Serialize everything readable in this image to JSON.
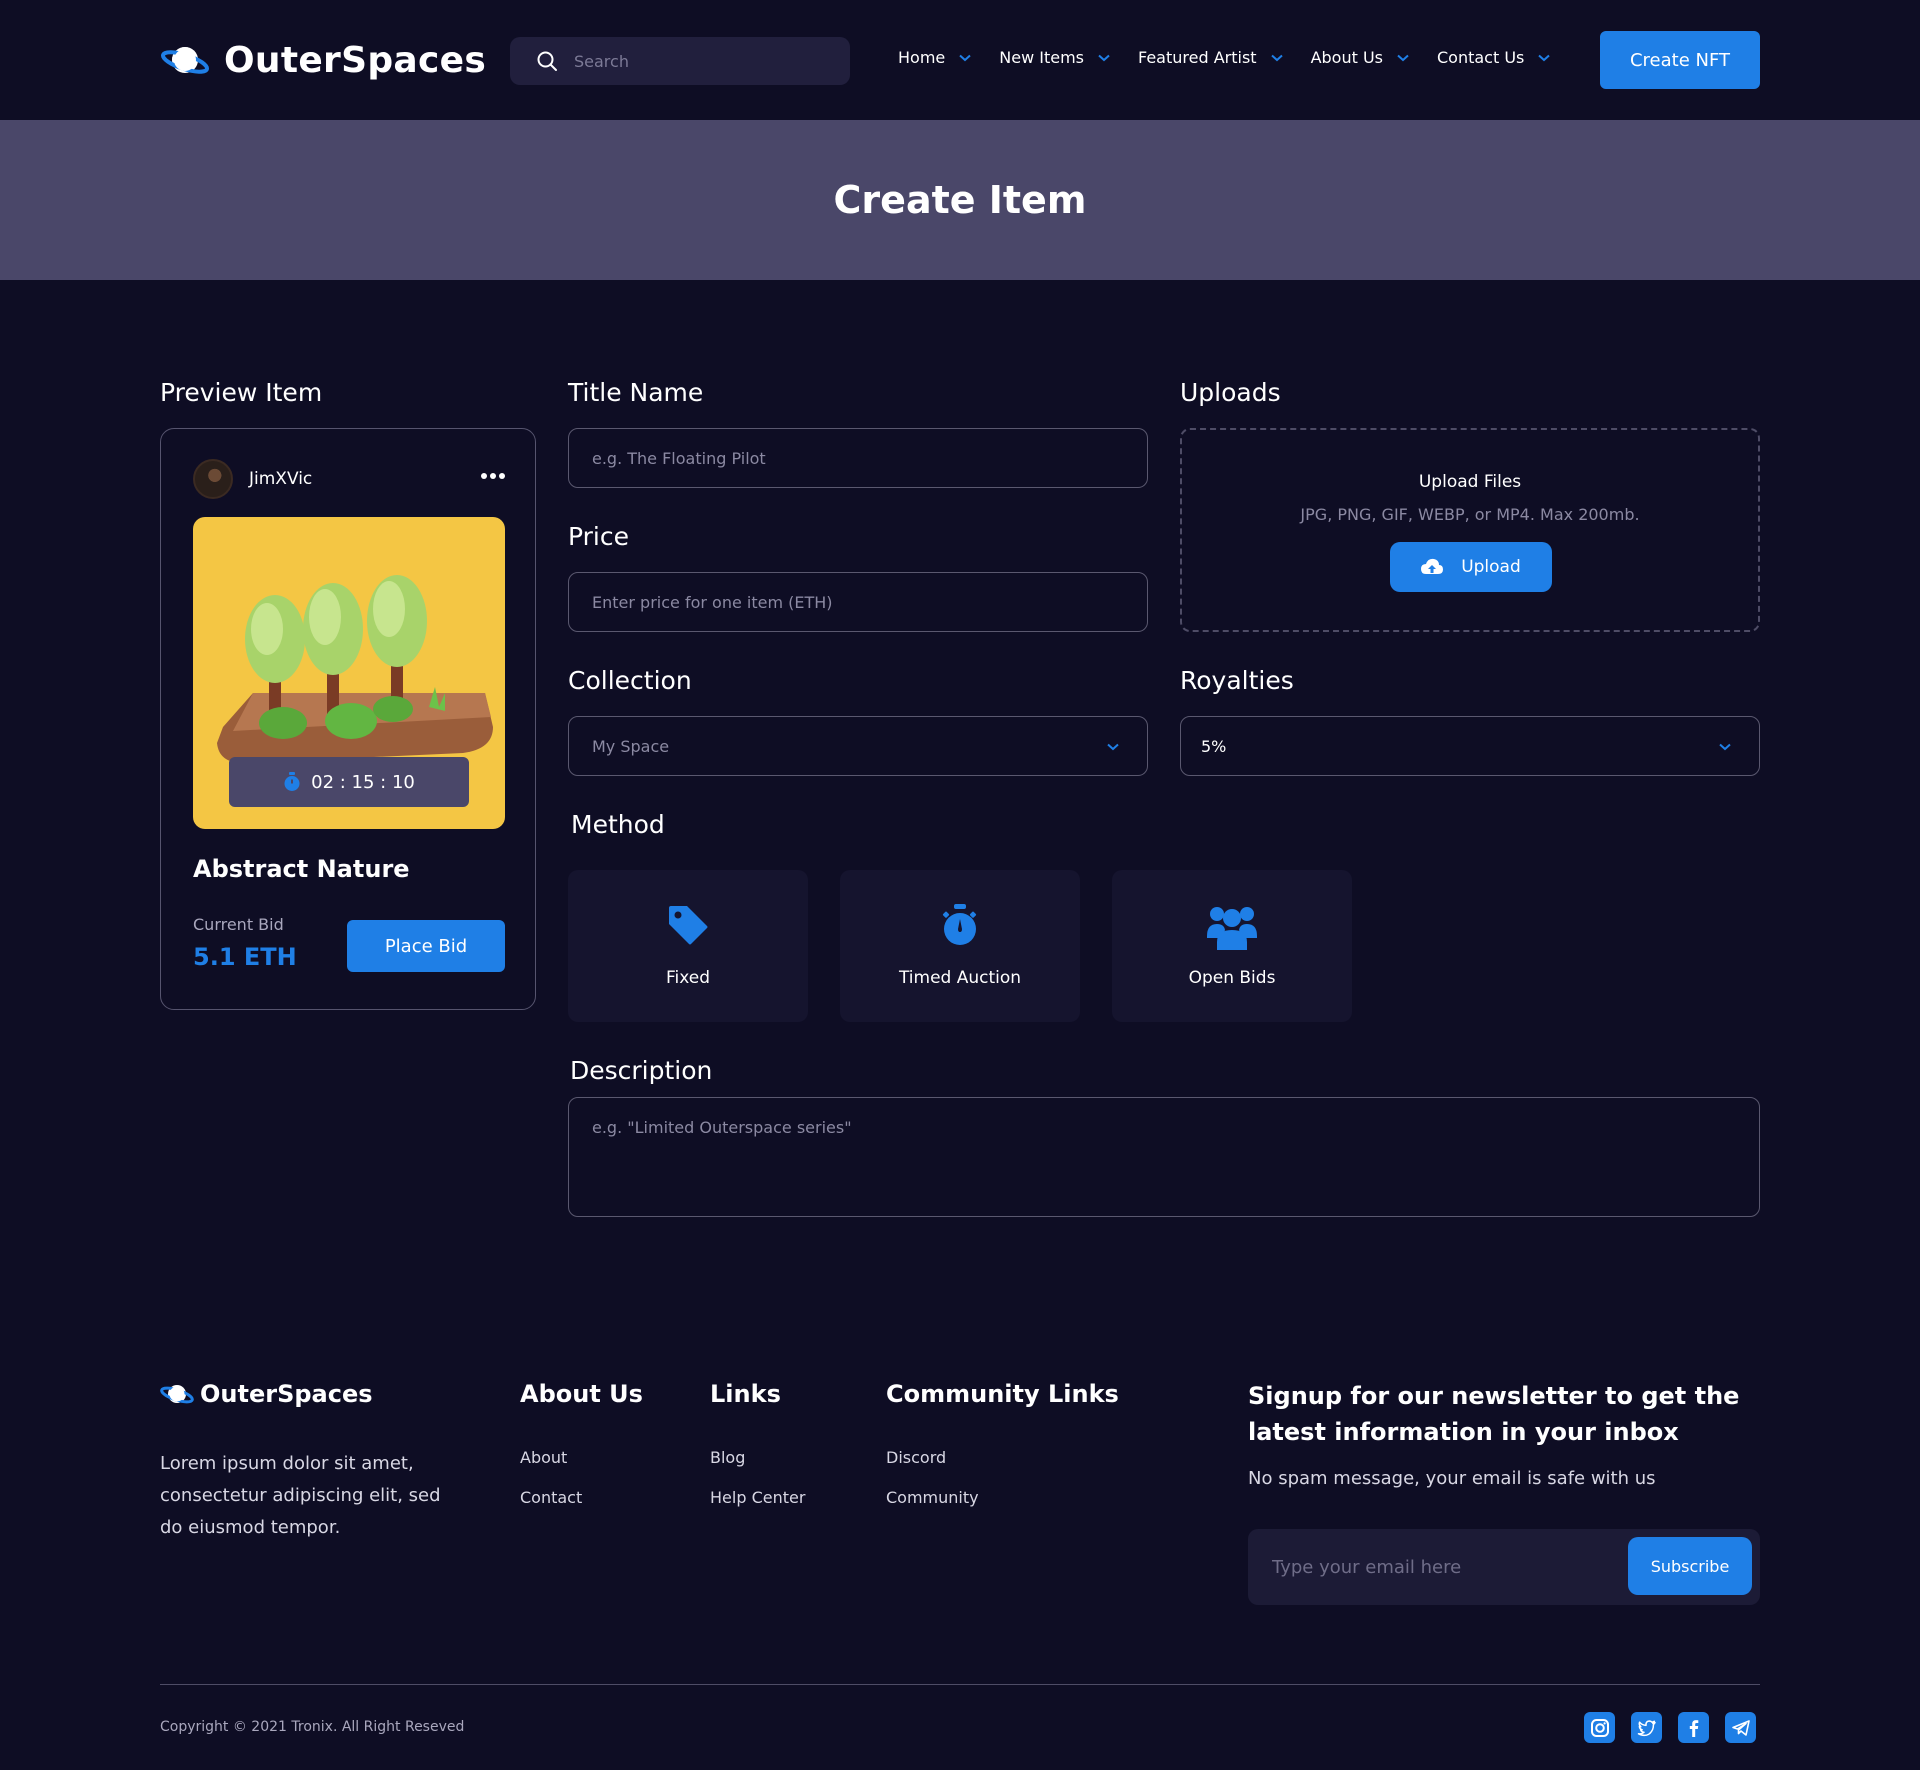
{
  "header": {
    "brand": "OuterSpaces",
    "search_placeholder": "Search",
    "nav": [
      "Home",
      "New Items",
      "Featured Artist",
      "About Us",
      "Contact Us"
    ],
    "create_button": "Create NFT"
  },
  "banner": {
    "title": "Create Item"
  },
  "preview": {
    "section_label": "Preview Item",
    "username": "JimXVic",
    "timer": "02 : 15 : 10",
    "item_title": "Abstract Nature",
    "bid_label": "Current Bid",
    "bid_value": "5.1 ETH",
    "bid_button": "Place Bid"
  },
  "form": {
    "title_label": "Title Name",
    "title_placeholder": "e.g. The Floating Pilot",
    "price_label": "Price",
    "price_placeholder": "Enter price for one item (ETH)",
    "collection_label": "Collection",
    "collection_value": "My Space",
    "uploads_label": "Uploads",
    "upload_title": "Upload Files",
    "upload_sub": "JPG, PNG, GIF, WEBP, or MP4. Max 200mb.",
    "upload_button": "Upload",
    "royalties_label": "Royalties",
    "royalties_value": "5%",
    "method_label": "Method",
    "methods": [
      {
        "label": "Fixed",
        "icon": "tag-icon"
      },
      {
        "label": "Timed Auction",
        "icon": "stopwatch-icon"
      },
      {
        "label": "Open Bids",
        "icon": "users-icon"
      }
    ],
    "description_label": "Description",
    "description_placeholder": "e.g. \"Limited Outerspace series\""
  },
  "footer": {
    "brand": "OuterSpaces",
    "about_text": "Lorem ipsum dolor sit amet, consectetur adipiscing elit, sed do eiusmod tempor.",
    "about_heading": "About Us",
    "about_links": [
      "About",
      "Contact"
    ],
    "links_heading": "Links",
    "links": [
      "Blog",
      "Help Center"
    ],
    "community_heading": "Community Links",
    "community_links": [
      "Discord",
      "Community"
    ],
    "newsletter_title": "Signup for our newsletter to get the latest information in your inbox",
    "newsletter_sub": "No spam message, your email is safe with us",
    "email_placeholder": "Type your email here",
    "subscribe_button": "Subscribe",
    "copyright": "Copyright © 2021 Tronix. All Right Reseved",
    "socials": [
      "instagram-icon",
      "twitter-icon",
      "facebook-icon",
      "telegram-icon"
    ]
  },
  "colors": {
    "background": "#0e0d24",
    "banner": "#4a4769",
    "accent": "#1f7fe6",
    "card_art": "#f4c644"
  }
}
